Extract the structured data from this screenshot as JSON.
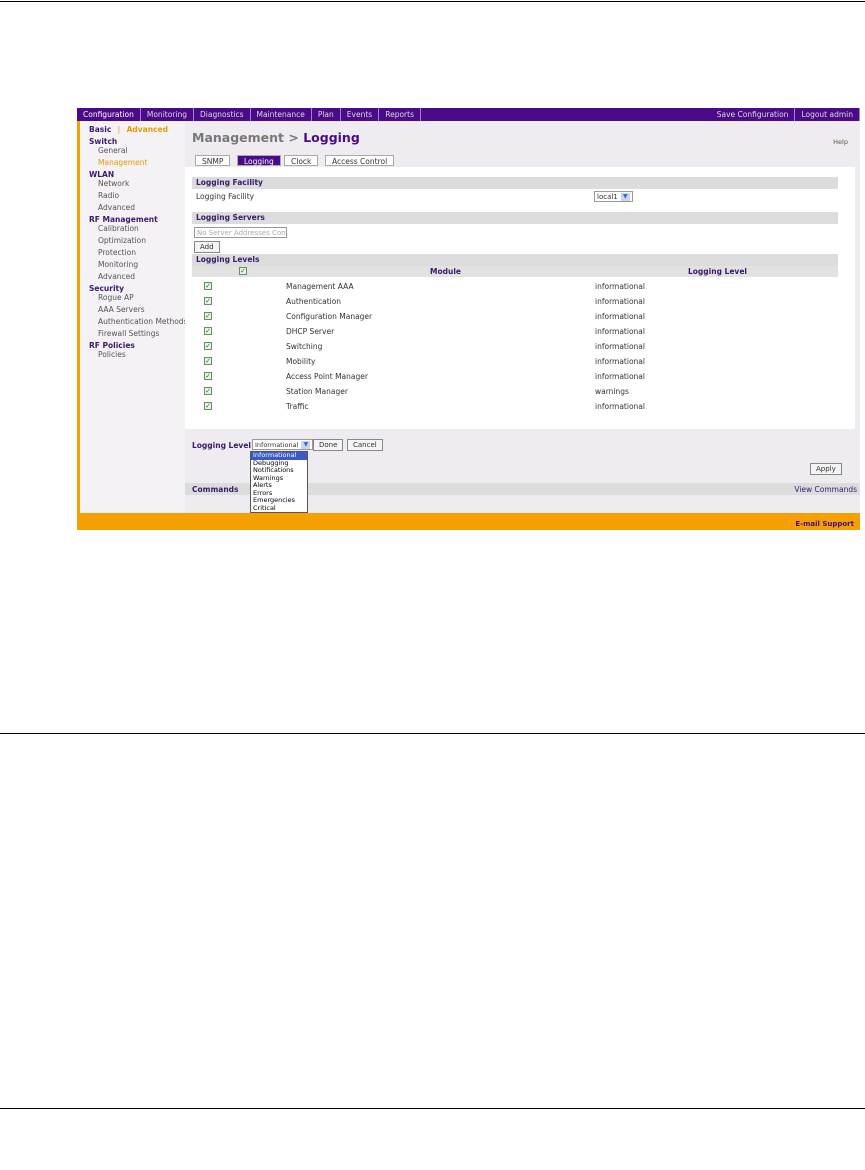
{
  "nav": {
    "items": [
      "Configuration",
      "Monitoring",
      "Diagnostics",
      "Maintenance",
      "Plan",
      "Events",
      "Reports"
    ],
    "right": [
      "Save Configuration",
      "Logout admin"
    ]
  },
  "sidebar": {
    "basic": "Basic",
    "sep": "|",
    "advanced": "Advanced",
    "groups": [
      {
        "title": "Switch",
        "items": [
          "General",
          "Management"
        ]
      },
      {
        "title": "WLAN",
        "items": [
          "Network",
          "Radio",
          "Advanced"
        ]
      },
      {
        "title": "RF Management",
        "items": [
          "Calibration",
          "Optimization",
          "Protection",
          "Monitoring",
          "Advanced"
        ]
      },
      {
        "title": "Security",
        "items": [
          "Rogue AP",
          "AAA Servers",
          "Authentication Methods",
          "Firewall Settings"
        ]
      },
      {
        "title": "RF Policies",
        "items": [
          "Policies"
        ]
      }
    ],
    "selected": "Management"
  },
  "header": {
    "title_prefix": "Management >",
    "title": "Logging",
    "help": "Help"
  },
  "tabs": [
    "SNMP",
    "Logging",
    "Clock",
    "Access Control"
  ],
  "active_tab": "Logging",
  "facility": {
    "section": "Logging Facility",
    "label": "Logging Facility",
    "value": "local1"
  },
  "servers": {
    "section": "Logging Servers",
    "placeholder": "No Server Addresses Configured",
    "add": "Add"
  },
  "levels": {
    "section": "Logging Levels",
    "columns": [
      "Module",
      "Logging Level"
    ],
    "rows": [
      {
        "module": "Management AAA",
        "level": "informational",
        "checked": true
      },
      {
        "module": "Authentication",
        "level": "informational",
        "checked": true
      },
      {
        "module": "Configuration Manager",
        "level": "informational",
        "checked": true
      },
      {
        "module": "DHCP Server",
        "level": "informational",
        "checked": true
      },
      {
        "module": "Switching",
        "level": "informational",
        "checked": true
      },
      {
        "module": "Mobility",
        "level": "informational",
        "checked": true
      },
      {
        "module": "Access Point Manager",
        "level": "informational",
        "checked": true
      },
      {
        "module": "Station Manager",
        "level": "warnings",
        "checked": true
      },
      {
        "module": "Traffic",
        "level": "informational",
        "checked": true
      }
    ]
  },
  "level_bar": {
    "label": "Logging Level",
    "value": "Informational",
    "done": "Done",
    "cancel": "Cancel",
    "options": [
      "Informational",
      "Debugging",
      "Notifications",
      "Warnings",
      "Alerts",
      "Errors",
      "Emergencies",
      "Critical"
    ]
  },
  "apply": "Apply",
  "commands": {
    "label": "Commands",
    "view": "View Commands"
  },
  "footer": {
    "support": "E-mail Support"
  }
}
